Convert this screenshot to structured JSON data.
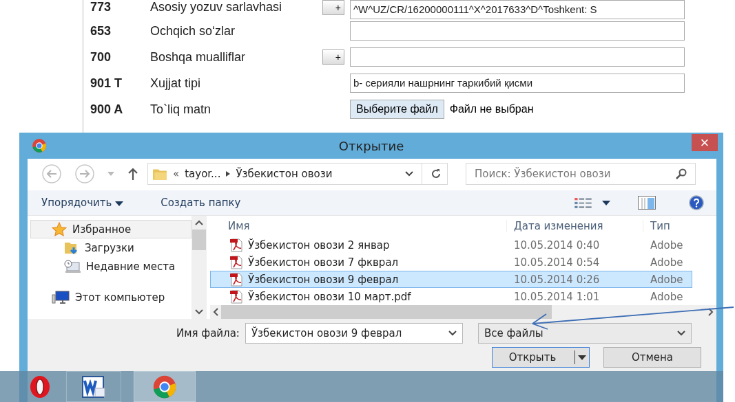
{
  "form": {
    "rows": [
      {
        "code": "773",
        "label": "Asosiy yozuv sarlavhasi",
        "kind": "text",
        "add_button": "+",
        "value": "^W^UZ/CR/16200000111^X^2017633^D^Toshkent: S"
      },
      {
        "code": "653",
        "label": "Ochqich so‘zlar",
        "kind": "text"
      },
      {
        "code": "700",
        "label": "Boshqa mualliflar",
        "kind": "text",
        "add_button": "+"
      },
      {
        "code": "901 T",
        "label": "Xujjat tipi",
        "kind": "text",
        "value": "b- серияли нашрнинг таркибий қисми"
      },
      {
        "code": "900 A",
        "label": "To`liq matn",
        "kind": "file",
        "button": "Выберите файл",
        "status": "Файл не выбран"
      }
    ]
  },
  "dialog": {
    "title": "Открытие",
    "close": "×",
    "address": {
      "overflow_mark": "«",
      "path": [
        "tayor...",
        "Ўзбекистон овози"
      ]
    },
    "search": {
      "placeholder": "Поиск: Ўзбекистон овози"
    },
    "toolbar": {
      "organize": "Упорядочить",
      "new_folder": "Создать папку"
    },
    "nav": [
      {
        "label": "Избранное",
        "selected": true,
        "children": [
          {
            "label": "Загрузки",
            "selected": false
          },
          {
            "label": "Недавние места",
            "selected": false
          }
        ]
      },
      {
        "label": "Этот компьютер",
        "selected": false
      }
    ],
    "columns": [
      "Имя",
      "Дата изменения",
      "Тип"
    ],
    "files": [
      {
        "name": "Ўзбекистон овози 2 январ",
        "date": "10.05.2014 0:40",
        "type": "Adobe",
        "selected": false
      },
      {
        "name": "Ўзбекистон овози 7 фкврал",
        "date": "10.05.2014 0:54",
        "type": "Adobe",
        "selected": false
      },
      {
        "name": "Ўзбекистон овози 9 феврал",
        "date": "10.05.2014 0:26",
        "type": "Adobe",
        "selected": true
      },
      {
        "name": "Ўзбекистон овози 10 март.pdf",
        "date": "10.05.2014 1:01",
        "type": "Adobe",
        "selected": false
      }
    ],
    "filename_label": "Имя файла:",
    "filename": "Ўзбекистон овози 9 феврал",
    "filter": "Все файлы",
    "buttons": [
      {
        "label": "Открыть",
        "kind": "split"
      },
      {
        "label": "Отмена",
        "kind": "plain"
      }
    ]
  },
  "taskbar": [
    {
      "selected": false
    },
    {
      "selected": false
    },
    {
      "selected": true
    }
  ]
}
